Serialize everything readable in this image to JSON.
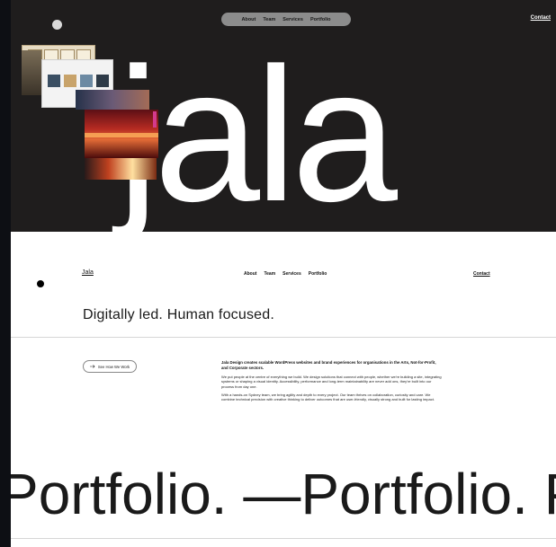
{
  "hero": {
    "nav": [
      {
        "label": "About"
      },
      {
        "label": "Team"
      },
      {
        "label": "Services"
      },
      {
        "label": "Portfolio"
      }
    ],
    "contact_label": "Contact",
    "wordmark": "Jala"
  },
  "site_nav": {
    "logo": "Jala",
    "links": [
      {
        "label": "About"
      },
      {
        "label": "Team"
      },
      {
        "label": "Services"
      },
      {
        "label": "Portfolio"
      }
    ],
    "contact_label": "Contact"
  },
  "tagline": "Digitally led. Human focused.",
  "cta": {
    "icon": "arrow-right-icon",
    "label": "See How We Work"
  },
  "intro": {
    "lead": "Jala Design creates scalable WordPress websites and brand experiences for organisations in the Arts, Not-for-Profit, and Corporate sectors.",
    "paragraph_1": "We put people at the centre of everything we build. We design solutions that connect with people, whether we're building a site, integrating systems or shaping a visual identity. Accessibility, performance and long-term maintainability are never add ons, they're built into our process from day one.",
    "paragraph_2": "With a hands-on Sydney team, we bring agility and depth to every project. Our team thrives on collaboration, curiosity and care. We combine technical precision with creative thinking to deliver outcomes that are user-friendly, visually strong and built for lasting impact."
  },
  "marquee": "Portfolio. —Portfolio. Portfolio.",
  "colors": {
    "hero_background": "#1f1d1d",
    "page_background": "#ffffff",
    "outer_background": "#0d0f14",
    "nav_pill": "#8c8c8c"
  }
}
